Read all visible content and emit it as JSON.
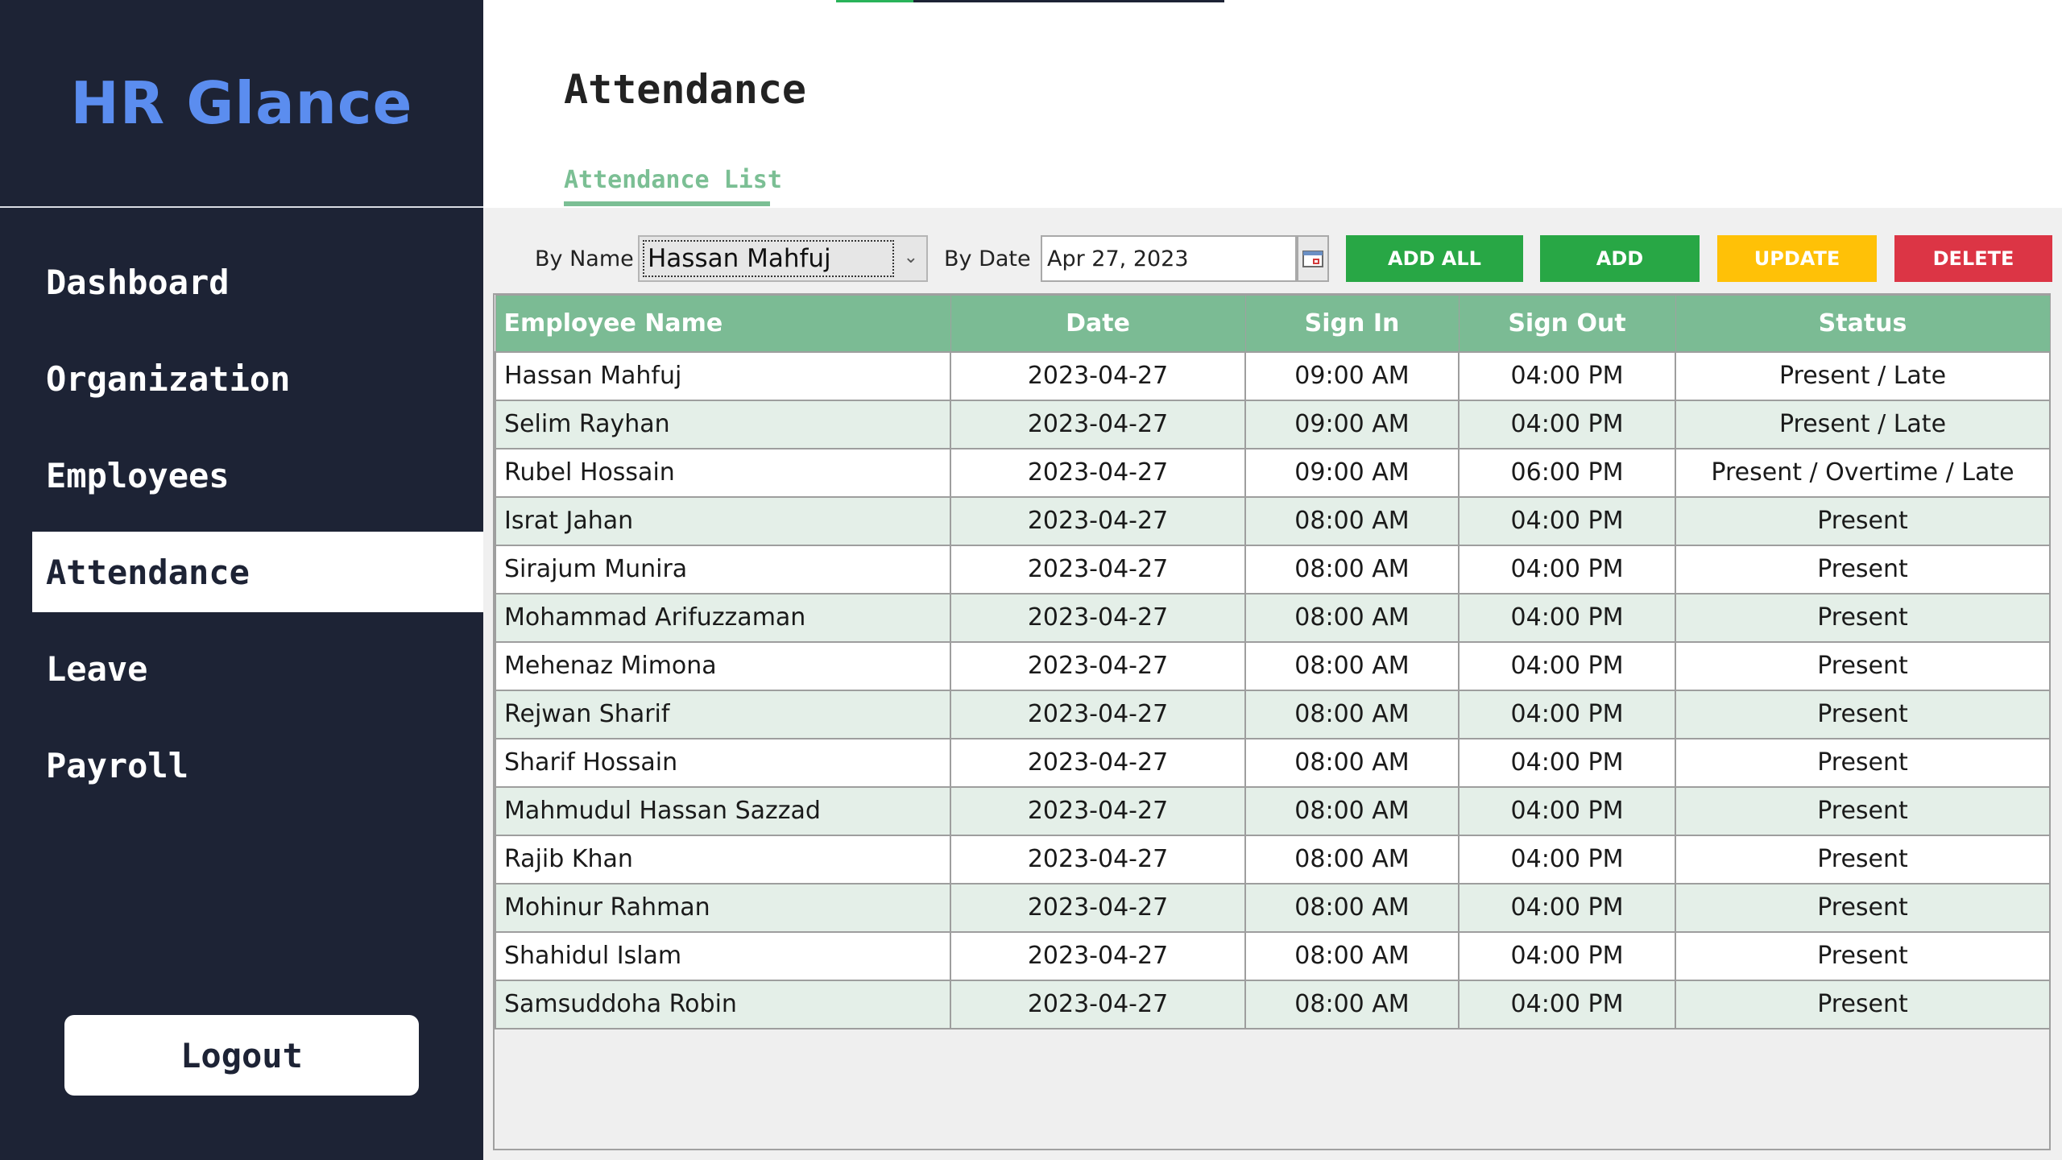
{
  "app": {
    "title": "HR Glance"
  },
  "sidebar": {
    "items": [
      {
        "label": "Dashboard"
      },
      {
        "label": "Organization"
      },
      {
        "label": "Employees"
      },
      {
        "label": "Attendance",
        "active": true
      },
      {
        "label": "Leave"
      },
      {
        "label": "Payroll"
      }
    ],
    "logout_label": "Logout"
  },
  "header": {
    "title": "Attendance",
    "tab": "Attendance List"
  },
  "filters": {
    "by_name_label": "By Name",
    "name_value": "Hassan Mahfuj",
    "by_date_label": "By Date",
    "date_value": "Apr 27, 2023",
    "calendar_icon": "calendar-icon"
  },
  "actions": {
    "add_all": "ADD ALL",
    "add": "ADD",
    "update": "UPDATE",
    "delete": "DELETE"
  },
  "colors": {
    "sidebar": "#1d2335",
    "brand": "#5b8def",
    "accent_green": "#7bbb94",
    "add": "#28a745",
    "update": "#ffc107",
    "delete": "#dc3545"
  },
  "table": {
    "columns": [
      "Employee Name",
      "Date",
      "Sign In",
      "Sign Out",
      "Status"
    ],
    "rows": [
      [
        "Hassan Mahfuj",
        "2023-04-27",
        "09:00 AM",
        "04:00 PM",
        "Present / Late"
      ],
      [
        "Selim Rayhan",
        "2023-04-27",
        "09:00 AM",
        "04:00 PM",
        "Present / Late"
      ],
      [
        "Rubel Hossain",
        "2023-04-27",
        "09:00 AM",
        "06:00 PM",
        "Present / Overtime / Late"
      ],
      [
        "Israt Jahan",
        "2023-04-27",
        "08:00 AM",
        "04:00 PM",
        "Present"
      ],
      [
        "Sirajum Munira",
        "2023-04-27",
        "08:00 AM",
        "04:00 PM",
        "Present"
      ],
      [
        "Mohammad Arifuzzaman",
        "2023-04-27",
        "08:00 AM",
        "04:00 PM",
        "Present"
      ],
      [
        "Mehenaz Mimona",
        "2023-04-27",
        "08:00 AM",
        "04:00 PM",
        "Present"
      ],
      [
        "Rejwan Sharif",
        "2023-04-27",
        "08:00 AM",
        "04:00 PM",
        "Present"
      ],
      [
        "Sharif Hossain",
        "2023-04-27",
        "08:00 AM",
        "04:00 PM",
        "Present"
      ],
      [
        "Mahmudul Hassan Sazzad",
        "2023-04-27",
        "08:00 AM",
        "04:00 PM",
        "Present"
      ],
      [
        "Rajib Khan",
        "2023-04-27",
        "08:00 AM",
        "04:00 PM",
        "Present"
      ],
      [
        "Mohinur Rahman",
        "2023-04-27",
        "08:00 AM",
        "04:00 PM",
        "Present"
      ],
      [
        "Shahidul Islam",
        "2023-04-27",
        "08:00 AM",
        "04:00 PM",
        "Present"
      ],
      [
        "Samsuddoha Robin",
        "2023-04-27",
        "08:00 AM",
        "04:00 PM",
        "Present"
      ]
    ]
  }
}
